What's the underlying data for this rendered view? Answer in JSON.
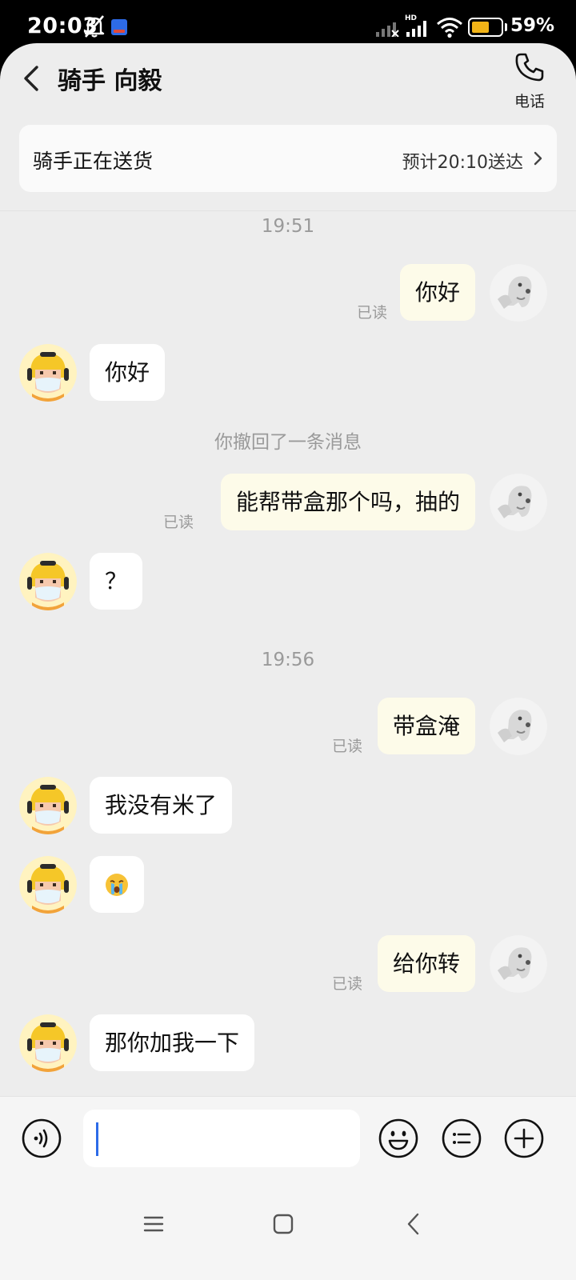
{
  "status_bar": {
    "time": "20:03",
    "hd_label": "HD",
    "battery_level": 0.59,
    "battery_text": "59%",
    "battery_color": "#f2b417",
    "icons": [
      "mute-bell-icon",
      "app-notification-icon",
      "signal-icon",
      "wifi-icon",
      "battery-icon"
    ]
  },
  "header": {
    "title": "骑手 向毅",
    "call_label": "电话"
  },
  "delivery": {
    "status": "骑手正在送货",
    "eta": "预计20:10送达"
  },
  "chat": {
    "time_1": "19:51",
    "time_2": "19:56",
    "recall_notice": "你撤回了一条消息",
    "read_label": "已读",
    "messages": [
      {
        "side": "out",
        "text": "你好"
      },
      {
        "side": "in",
        "text": "你好"
      },
      {
        "side": "out",
        "text": "能帮带盒那个吗，抽的"
      },
      {
        "side": "in",
        "text": "？"
      },
      {
        "side": "out",
        "text": "带盒淹"
      },
      {
        "side": "in",
        "text": "我没有米了"
      },
      {
        "side": "in",
        "text": "",
        "emoji": "crying-face-emoji"
      },
      {
        "side": "out",
        "text": "给你转"
      },
      {
        "side": "in",
        "text": "那你加我一下"
      }
    ]
  },
  "input": {
    "value": "",
    "placeholder": ""
  },
  "colors": {
    "outgoing_bubble": "#fdfbe9",
    "incoming_bubble": "#ffffff",
    "background": "#ededed",
    "cursor": "#2d6be8"
  }
}
